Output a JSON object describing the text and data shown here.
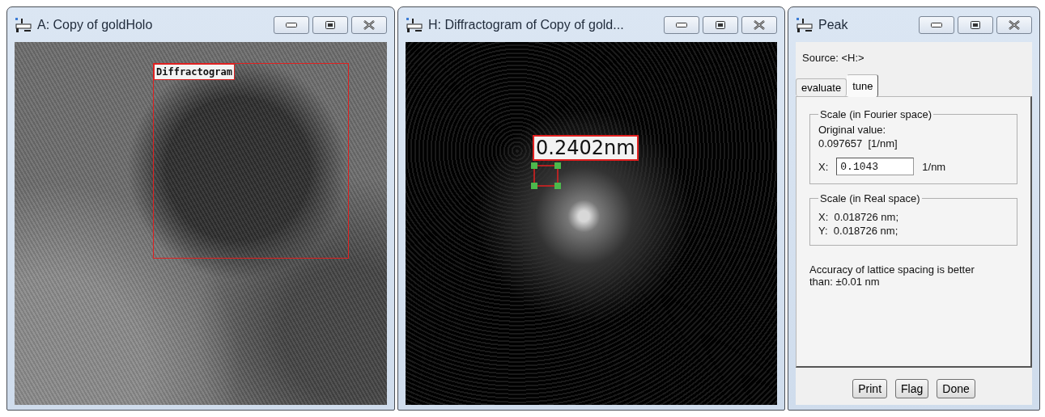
{
  "windows": [
    {
      "title": "A: Copy of goldHolo",
      "kind": "image",
      "overlay": {
        "kind": "region",
        "label": "Diffractogram"
      }
    },
    {
      "title": "H: Diffractogram of Copy of gold...",
      "kind": "image",
      "overlay": {
        "kind": "peak",
        "label": "0.2402nm"
      }
    },
    {
      "title": "Peak",
      "kind": "panel"
    }
  ],
  "peak": {
    "source": "Source: <H:>",
    "tabs": [
      {
        "label": "evaluate",
        "selected": false
      },
      {
        "label": "tune",
        "selected": true
      }
    ],
    "fourier": {
      "title": "Scale (in Fourier space)",
      "original_label": "Original value:",
      "original_value": "0.097657  [1/nm]",
      "x_label": "X:",
      "x_value": "0.1043",
      "x_unit": "1/nm"
    },
    "real": {
      "title": "Scale (in Real space)",
      "lines": [
        "X:  0.018726 nm;",
        "Y:  0.018726 nm;"
      ]
    },
    "accuracy": "Accuracy of lattice spacing is better than: ±0.01 nm",
    "buttons": [
      "Print",
      "Flag",
      "Done"
    ]
  }
}
